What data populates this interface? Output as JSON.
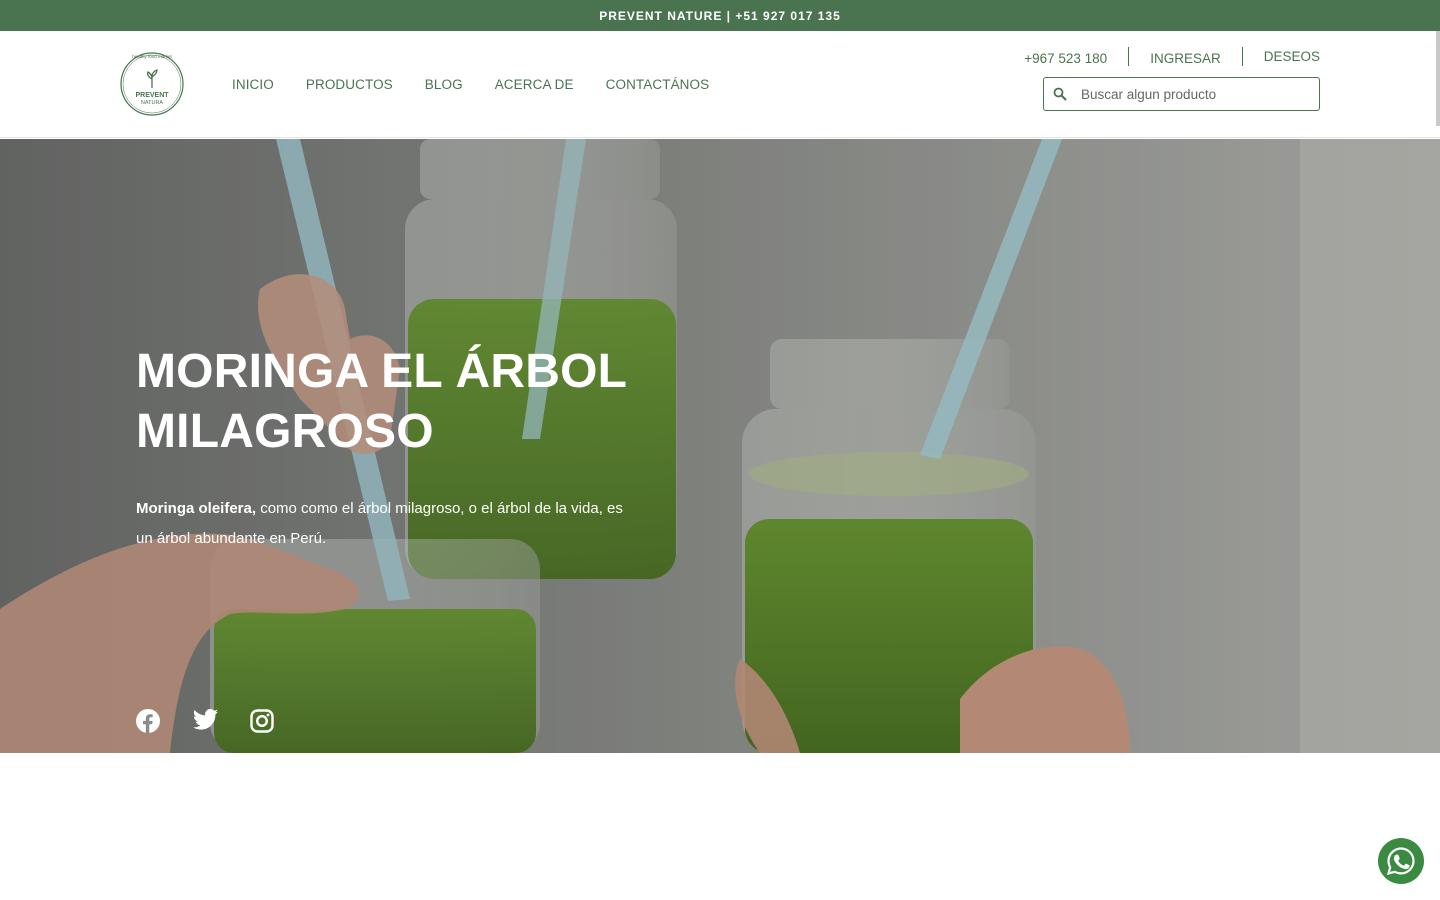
{
  "topbar": {
    "text": "PREVENT NATURE | +51 927 017 135"
  },
  "logo": {
    "arc_text": "healthy food market",
    "line1": "PREVENT",
    "line2": "NATURA"
  },
  "nav": {
    "items": [
      {
        "label": "INICIO"
      },
      {
        "label": "PRODUCTOS"
      },
      {
        "label": "BLOG"
      },
      {
        "label": "ACERCA DE"
      },
      {
        "label": "CONTACTÁNOS"
      }
    ]
  },
  "header_right": {
    "phone": "+967 523 180",
    "login": "INGRESAR",
    "wishlist": "DESEOS"
  },
  "search": {
    "placeholder": "Buscar algun producto",
    "icon": "search-icon"
  },
  "hero": {
    "title": "MORINGA EL ÁRBOL MILAGROSO",
    "text_bold": "Moringa oleifera,",
    "text_rest": " como como el árbol milagroso, o el árbol de la vida, es un árbol abundante en Perú.",
    "social": [
      "facebook-icon",
      "twitter-icon",
      "instagram-icon"
    ]
  },
  "colors": {
    "brand": "#4a7450",
    "whatsapp": "#3a8a42",
    "juice": "#5f8a2e"
  }
}
